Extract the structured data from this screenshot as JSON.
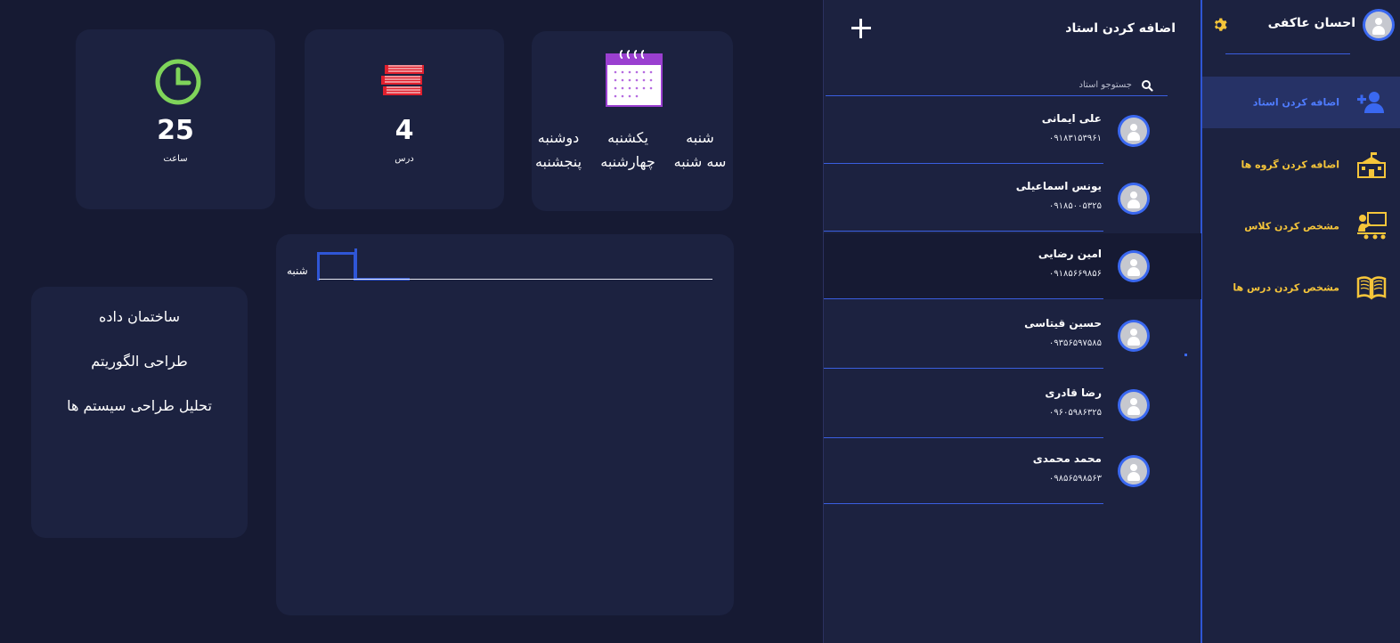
{
  "sidebar": {
    "profile_name": "احسان عاکفی",
    "items": [
      {
        "label": "اضافه کردن استاد",
        "icon": "add-user-icon",
        "active": true
      },
      {
        "label": "اضافه کردن گروه ها",
        "icon": "school-building-icon",
        "active": false
      },
      {
        "label": "مشخص کردن کلاس",
        "icon": "teacher-board-icon",
        "active": false
      },
      {
        "label": "مشخص کردن درس ها",
        "icon": "open-book-icon",
        "active": false
      }
    ]
  },
  "teachers": {
    "title": "اضافه کردن استاد",
    "search_placeholder": "جستوجو استاد",
    "list": [
      {
        "name": "علی ایمانی",
        "phone": "۰۹۱۸۳۱۵۳۹۶۱"
      },
      {
        "name": "یونس اسماعیلی",
        "phone": "۰۹۱۸۵۰۰۵۳۲۵"
      },
      {
        "name": "امین رضایی",
        "phone": "۰۹۱۸۵۶۶۹۸۵۶"
      },
      {
        "name": "حسین قیتاسی",
        "phone": "۰۹۳۵۶۵۹۷۵۸۵"
      },
      {
        "name": "رضا قادری",
        "phone": "۰۹۶۰۵۹۸۶۳۲۵"
      },
      {
        "name": "محمد محمدی",
        "phone": "۰۹۸۵۶۵۹۸۵۶۳"
      }
    ]
  },
  "stats": {
    "days": [
      "شنبه",
      "یکشنبه",
      "دوشنبه",
      "سه شنبه",
      "چهارشنبه",
      "پنجشنبه"
    ],
    "lessons_value": "4",
    "lessons_label": "درس",
    "hours_value": "25",
    "hours_label": "ساعت"
  },
  "schedule": {
    "day_label": "شنبه"
  },
  "courses": [
    "ساختمان داده",
    "طراحی الگوریتم",
    "تحلیل طراحی سیستم ها"
  ],
  "colors": {
    "background": "#161a33",
    "panel": "#1c2240",
    "accent_blue": "#2f56d6",
    "nav_yellow": "#f5c53a",
    "nav_active_text": "#4f7cff"
  }
}
